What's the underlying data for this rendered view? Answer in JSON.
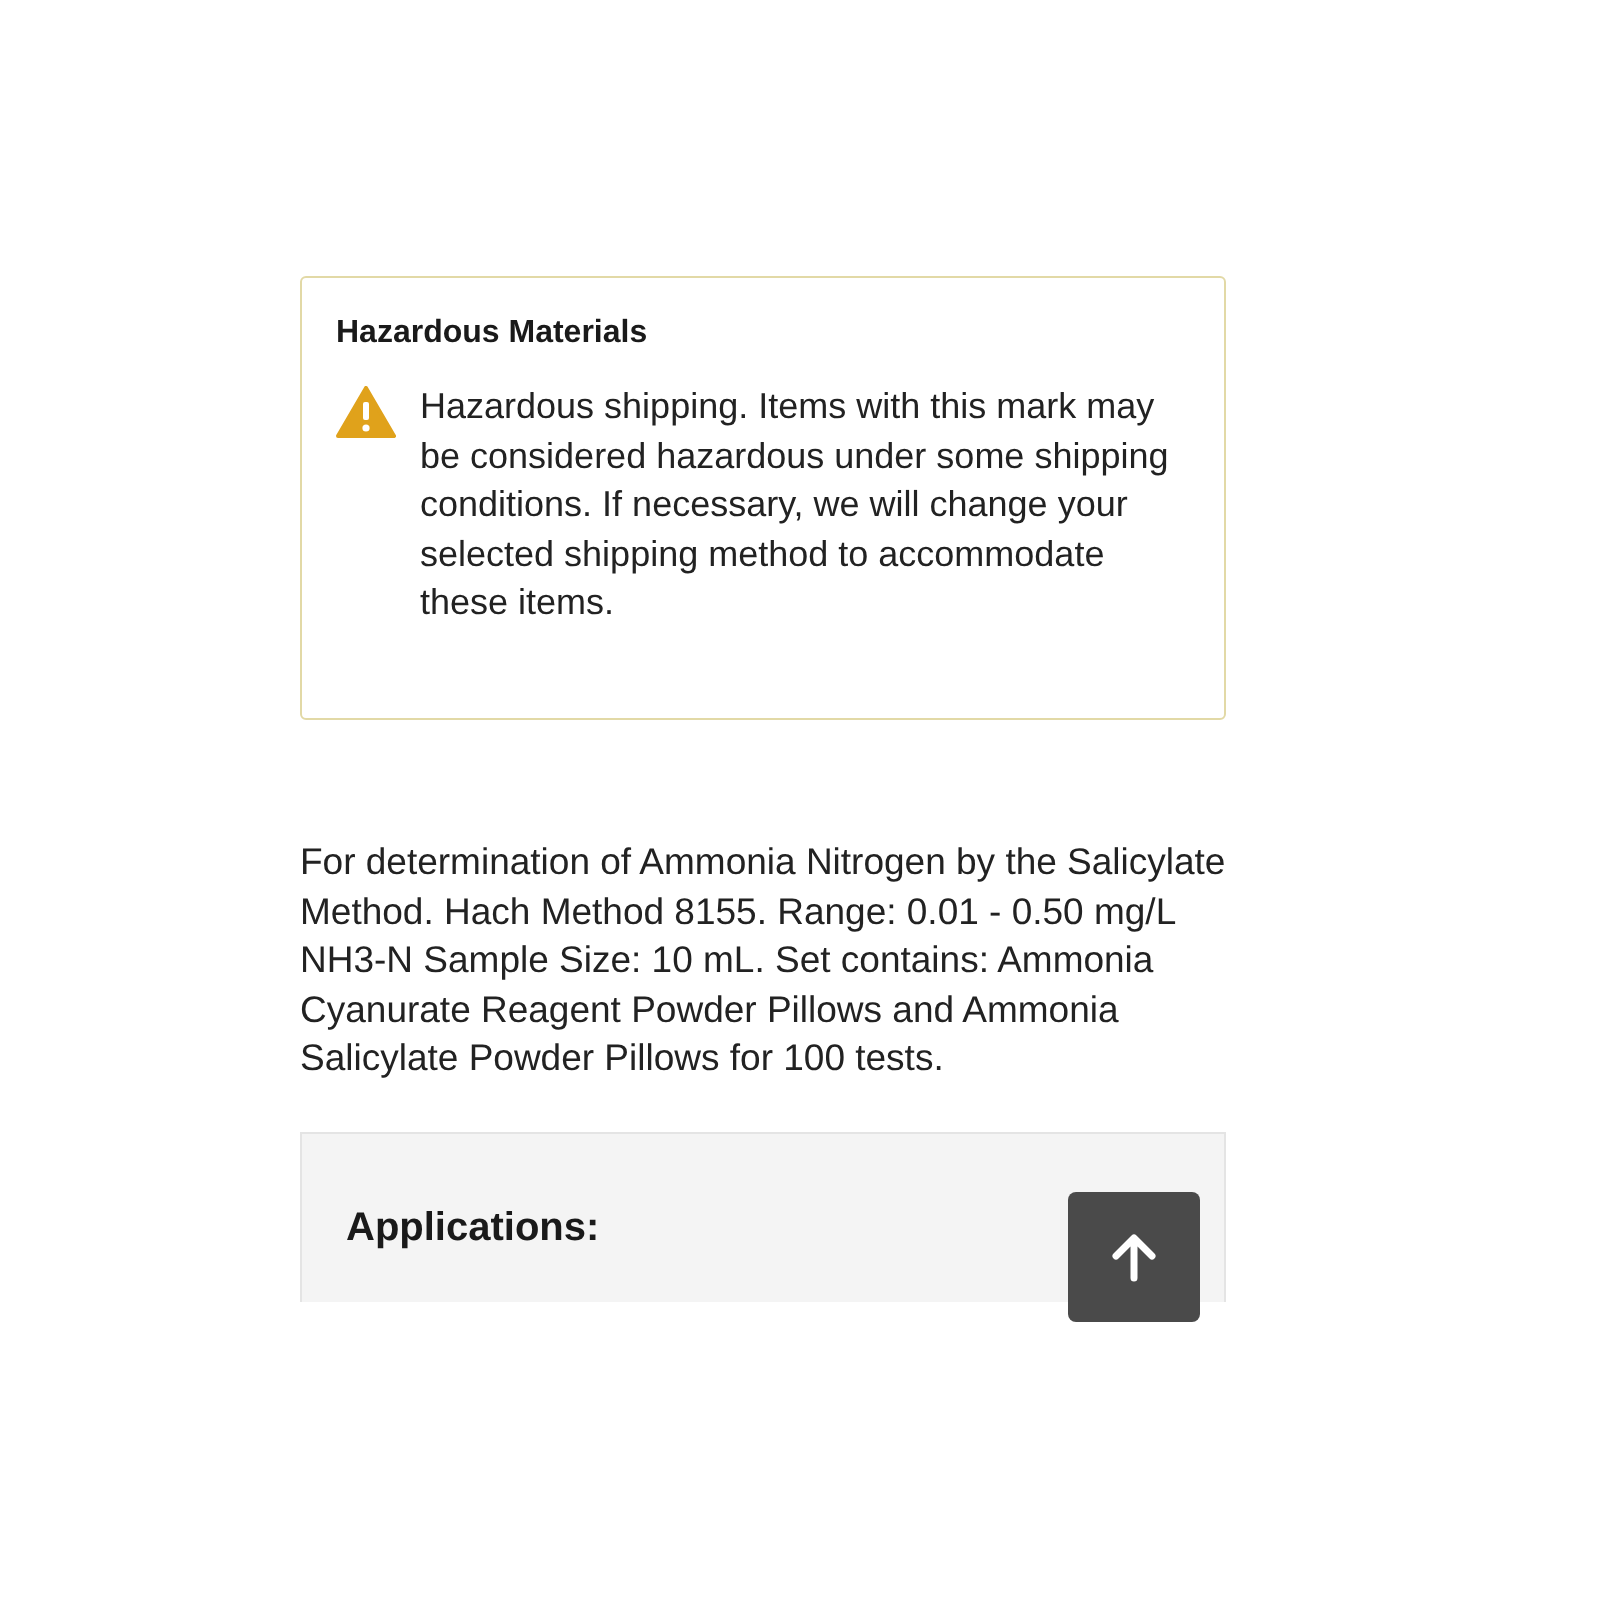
{
  "hazard_notice": {
    "title": "Hazardous Materials",
    "message": "Hazardous shipping. Items with this mark may be considered hazardous under some shipping conditions. If necessary, we will change your selected shipping method to accommodate these items."
  },
  "description": "For determination of Ammonia Nitrogen by the Salicylate Method. Hach Method 8155. Range: 0.01 - 0.50 mg/L NH3-N Sample Size: 10 mL. Set contains: Ammonia Cyanurate Reagent Powder Pillows and Ammonia Salicylate Powder Pillows for 100 tests.",
  "applications": {
    "heading": "Applications:"
  }
}
